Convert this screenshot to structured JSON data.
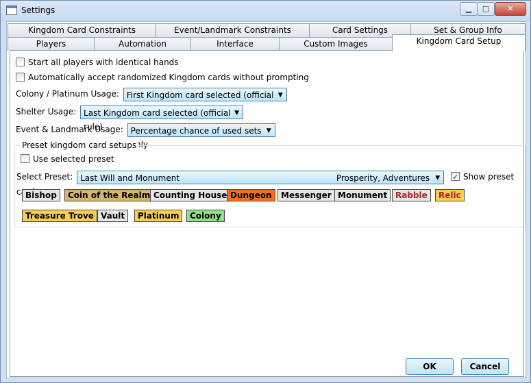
{
  "window": {
    "title": "Settings",
    "minimize_glyph": "▁",
    "maximize_glyph": "□",
    "close_glyph": "✕"
  },
  "tabs": {
    "row1": [
      "Kingdom Card Constraints",
      "Event/Landmark Constraints",
      "Card Settings",
      "Set & Group Info"
    ],
    "row2": [
      "Players",
      "Automation",
      "Interface",
      "Custom Images",
      "Kingdom Card Setup"
    ],
    "selected": "Kingdom Card Setup"
  },
  "options": {
    "identical_hands": {
      "label": "Start all players with identical hands",
      "checked": false
    },
    "auto_accept": {
      "label": "Automatically accept randomized Kingdom cards without prompting",
      "checked": false
    },
    "colony_label": "Colony / Platinum Usage:",
    "colony_value": "First Kingdom card selected (official rule)",
    "shelter_label": "Shelter Usage:",
    "shelter_value": "Last Kingdom card selected (official rule)",
    "event_label": "Event & Landmark Usage:",
    "event_value": "Percentage chance of used sets only"
  },
  "preset": {
    "group_label": "Preset kingdom card setups",
    "use_selected": {
      "label": "Use selected preset",
      "checked": false
    },
    "select_label": "Select Preset:",
    "selected_name": "Last Will and Monument",
    "selected_sets": "Prosperity, Adventures",
    "show_cards": {
      "label": "Show preset cards",
      "checked": true
    },
    "cards": [
      {
        "name": "Bishop",
        "bg": "#e6e6e6",
        "fg": "#000000"
      },
      {
        "name": "Coin of the Realm",
        "bg": "#d6b56a",
        "fg": "#000000"
      },
      {
        "name": "Counting House",
        "bg": "#e6e6e6",
        "fg": "#000000"
      },
      {
        "name": "Dungeon",
        "bg": "#f0701e",
        "fg": "#000000"
      },
      {
        "name": "Messenger",
        "bg": "#e6e6e6",
        "fg": "#000000"
      },
      {
        "name": "Monument",
        "bg": "#e6e6e6",
        "fg": "#000000"
      },
      {
        "name": "Rabble",
        "bg": "#e6e6e6",
        "fg": "#b22222"
      },
      {
        "name": "Relic",
        "bg": "#f7cf55",
        "fg": "#b22222"
      },
      {
        "name": "Treasure Trove",
        "bg": "#f7cf55",
        "fg": "#000000"
      },
      {
        "name": "Vault",
        "bg": "#e6e6e6",
        "fg": "#000000"
      },
      {
        "name": "Platinum",
        "bg": "#f7cf55",
        "fg": "#000000"
      },
      {
        "name": "Colony",
        "bg": "#8ee08e",
        "fg": "#000000"
      }
    ]
  },
  "buttons": {
    "ok": "OK",
    "cancel": "Cancel"
  }
}
